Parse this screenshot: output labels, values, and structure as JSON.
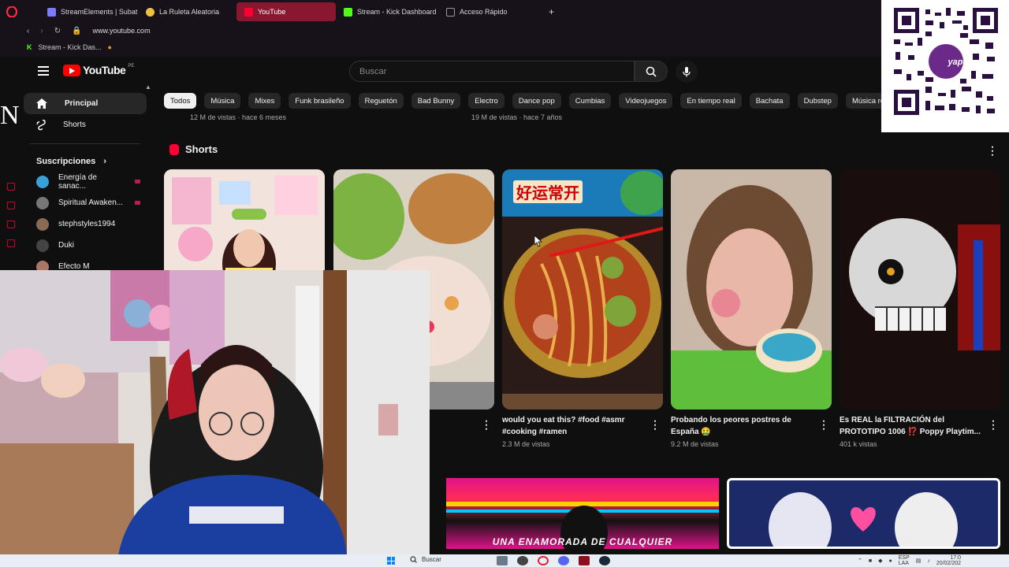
{
  "browser": {
    "tabs": [
      {
        "label": "StreamElements | Subatho",
        "color": "#7b7bff"
      },
      {
        "label": "La Ruleta Aleatoria",
        "color": "#f0c040"
      },
      {
        "label": "YouTube",
        "color": "#ff0033",
        "active": true
      },
      {
        "label": "Stream - Kick Dashboard",
        "color": "#53fc18"
      },
      {
        "label": "Acceso Rápido",
        "color": "#999999"
      }
    ],
    "new_tab_label": "+",
    "url": "www.youtube.com",
    "bookmark_label": "Stream - Kick Das..."
  },
  "youtube": {
    "logo_text": "YouTube",
    "country_code": "PE",
    "search_placeholder": "Buscar",
    "nav": {
      "main": [
        {
          "label": "Principal",
          "icon": "home-icon",
          "active": true
        },
        {
          "label": "Shorts",
          "icon": "shorts-icon"
        }
      ],
      "subscriptions_heading": "Suscripciones",
      "subscriptions": [
        {
          "label": "Energía de sanac...",
          "color": "#3aa0d8",
          "live": true
        },
        {
          "label": "Spiritual Awaken...",
          "color": "#777777",
          "live": true
        },
        {
          "label": "stephstyles1994",
          "color": "#8a6a55"
        },
        {
          "label": "Duki",
          "color": "#444444"
        },
        {
          "label": "Efecto M",
          "color": "#aa7766"
        }
      ]
    },
    "chips": [
      "Todos",
      "Música",
      "Mixes",
      "Funk brasileño",
      "Reguetón",
      "Bad Bunny",
      "Electro",
      "Dance pop",
      "Cumbias",
      "Videojuegos",
      "En tiempo real",
      "Bachata",
      "Dubstep",
      "Música regional"
    ],
    "prev_meta": [
      "12 M de vistas · hace 6 meses",
      "19 M de vistas · hace 7 años"
    ],
    "shorts_heading": "Shorts",
    "shorts": [
      {
        "title": "",
        "views": ""
      },
      {
        "title": "",
        "views": ""
      },
      {
        "title": "would you eat this? #food #asmr #cooking #ramen",
        "views": "2.3 M de vistas"
      },
      {
        "title": "Probando los peores postres de España 🤮",
        "views": "9.2 M de vistas"
      },
      {
        "title": "Es REAL la FILTRACIÓN del PROTOTIPO 1006 ⁉️ Poppy Playtim...",
        "views": "401 k vistas"
      }
    ],
    "ramen_sign": "好运常开",
    "bottom_caption": "UNA ENAMORADA DE CUALQUIER"
  },
  "qr_label": "yape",
  "taskbar": {
    "search_label": "Buscar",
    "lang": "ESP",
    "lang_sub": "LAA",
    "time": "17:0",
    "date": "20/02/202"
  }
}
